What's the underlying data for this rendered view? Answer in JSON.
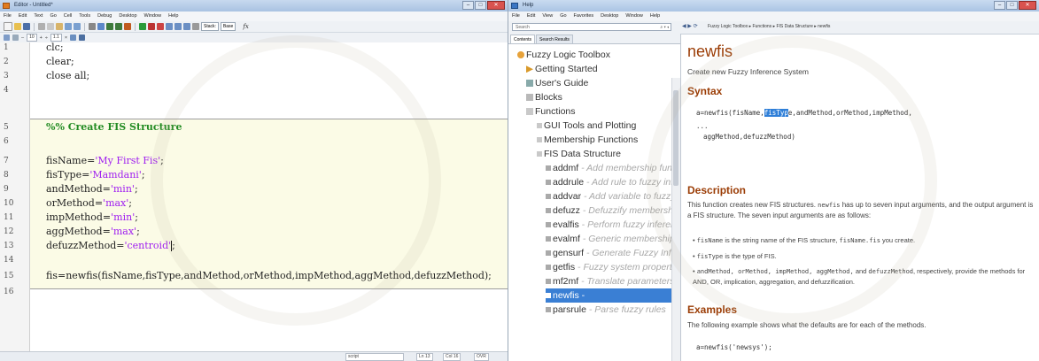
{
  "editor": {
    "title": "Editor - Untitled*",
    "menu": [
      "File",
      "Edit",
      "Text",
      "Go",
      "Cell",
      "Tools",
      "Debug",
      "Desktop",
      "Window",
      "Help"
    ],
    "stack_label": "Stack:",
    "stack_value": "Base",
    "fx_label": "fx",
    "font_size": "10",
    "font_step": "1.1",
    "lines": [
      {
        "n": "1",
        "code": "clc;"
      },
      {
        "n": "2",
        "code": "clear;"
      },
      {
        "n": "3",
        "code": "close all;"
      },
      {
        "n": "4",
        "code": ""
      },
      {
        "n": "5",
        "code": "%% Create FIS Structure"
      },
      {
        "n": "6",
        "code": ""
      },
      {
        "n": "7",
        "pre": "fisName=",
        "str": "'My First Fis'",
        "post": ";"
      },
      {
        "n": "8",
        "pre": "fisType=",
        "str": "'Mamdani'",
        "post": ";"
      },
      {
        "n": "9",
        "pre": "andMethod=",
        "str": "'min'",
        "post": ";"
      },
      {
        "n": "10",
        "pre": "orMethod=",
        "str": "'max'",
        "post": ";"
      },
      {
        "n": "11",
        "pre": "impMethod=",
        "str": "'min'",
        "post": ";"
      },
      {
        "n": "12",
        "pre": "aggMethod=",
        "str": "'max'",
        "post": ";"
      },
      {
        "n": "13",
        "pre": "defuzzMethod=",
        "str": "'centroid'",
        "post": ";"
      },
      {
        "n": "14",
        "code": ""
      },
      {
        "n": "15",
        "code": "fis=newfis(fisName,fisType,andMethod,orMethod,impMethod,aggMethod,defuzzMethod);"
      },
      {
        "n": "16",
        "code": ""
      }
    ],
    "status": {
      "mode": "script",
      "ln": "Ln 13",
      "col": "Col 16",
      "ovr": "OVR"
    }
  },
  "help": {
    "title": "Help",
    "menu": [
      "File",
      "Edit",
      "View",
      "Go",
      "Favorites",
      "Desktop",
      "Window",
      "Help"
    ],
    "search_placeholder": "Search",
    "breadcrumb": "Fuzzy Logic Toolbox ▸ Functions ▸ FIS Data Structure ▸ newfis",
    "tabs": [
      "Contents",
      "Search Results"
    ],
    "tree": [
      {
        "label": "Fuzzy Logic Toolbox",
        "desc": ""
      },
      {
        "label": "Getting Started",
        "desc": ""
      },
      {
        "label": "User's Guide",
        "desc": ""
      },
      {
        "label": "Blocks",
        "desc": ""
      },
      {
        "label": "Functions",
        "desc": ""
      },
      {
        "label": "GUI Tools and Plotting",
        "desc": ""
      },
      {
        "label": "Membership Functions",
        "desc": ""
      },
      {
        "label": "FIS Data Structure",
        "desc": ""
      },
      {
        "label": "addmf",
        "desc": " - Add membership function t"
      },
      {
        "label": "addrule",
        "desc": " - Add rule to fuzzy inferenc"
      },
      {
        "label": "addvar",
        "desc": " - Add variable to fuzzy infer"
      },
      {
        "label": "defuzz",
        "desc": " - Defuzzify membership func"
      },
      {
        "label": "evalfis",
        "desc": " - Perform fuzzy inference cal"
      },
      {
        "label": "evalmf",
        "desc": " - Generic membership functi"
      },
      {
        "label": "gensurf",
        "desc": " - Generate Fuzzy Inference"
      },
      {
        "label": "getfis",
        "desc": " - Fuzzy system properties"
      },
      {
        "label": "mf2mf",
        "desc": " - Translate parameters betwe"
      },
      {
        "label": "newfis",
        "desc": " -"
      },
      {
        "label": "parsrule",
        "desc": " - Parse fuzzy rules"
      }
    ],
    "page": {
      "name": "newfis",
      "short": "Create new Fuzzy Inference System",
      "syntax_heading": "Syntax",
      "syntax_l1_a": "a=newfis(fisName,",
      "syntax_l1_sel": "fisTyp",
      "syntax_l1_b": "e,andMethod,orMethod,impMethod,",
      "syntax_l2": "...",
      "syntax_l3": "aggMethod,defuzzMethod)",
      "description_heading": "Description",
      "desc_p1_a": "This function creates new FIS structures. ",
      "desc_p1_code": "newfis",
      "desc_p1_b": " has up to seven input arguments, and the output argument is a FIS structure. The seven input arguments are as follows:",
      "bullet1_code": "fisName",
      "bullet1_a": " is the string name of the FIS structure, ",
      "bullet1_code2": "fisName.fis",
      "bullet1_b": " you create.",
      "bullet2_code": "fisType",
      "bullet2_a": " is the type of FIS.",
      "bullet3_code": "andMethod, orMethod, impMethod, aggMethod,",
      "bullet3_a": " and ",
      "bullet3_code2": "defuzzMethod",
      "bullet3_b": ", respectively, provide the methods for AND, OR, implication, aggregation, and defuzzification.",
      "examples_heading": "Examples",
      "examples_text": "The following example shows what the defaults are for each of the methods.",
      "examples_code": "a=newfis('newsys');"
    }
  }
}
